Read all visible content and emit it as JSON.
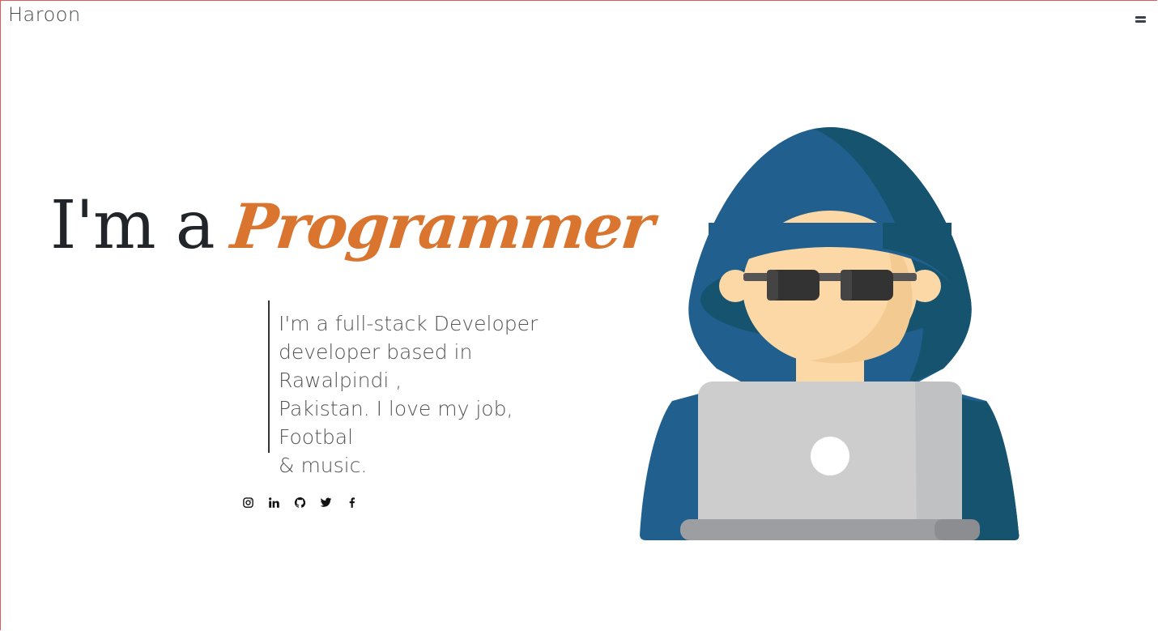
{
  "header": {
    "brand": "Haroon",
    "menu_icon": "hamburger-icon"
  },
  "hero": {
    "prefix": "I'm a",
    "role": "Programmer",
    "bio_lines": [
      "I'm a full-stack Developer",
      "developer based in",
      "Rawalpindi ,",
      "Pakistan. I love my job,",
      "Footbal",
      "& music."
    ],
    "accent_color": "#d9752f"
  },
  "socials": [
    {
      "name": "instagram",
      "icon": "instagram-icon"
    },
    {
      "name": "linkedin",
      "icon": "linkedin-icon"
    },
    {
      "name": "github",
      "icon": "github-icon"
    },
    {
      "name": "twitter",
      "icon": "twitter-icon"
    },
    {
      "name": "facebook",
      "icon": "facebook-icon"
    }
  ],
  "illustration": {
    "subject": "hooded-programmer-with-laptop",
    "colors": {
      "hood": "#21608e",
      "hood_shadow": "#16536f",
      "skin": "#fcd8a6",
      "glasses": "#333333",
      "laptop": "#cdcdce",
      "laptop_base": "#9d9ea1"
    }
  }
}
